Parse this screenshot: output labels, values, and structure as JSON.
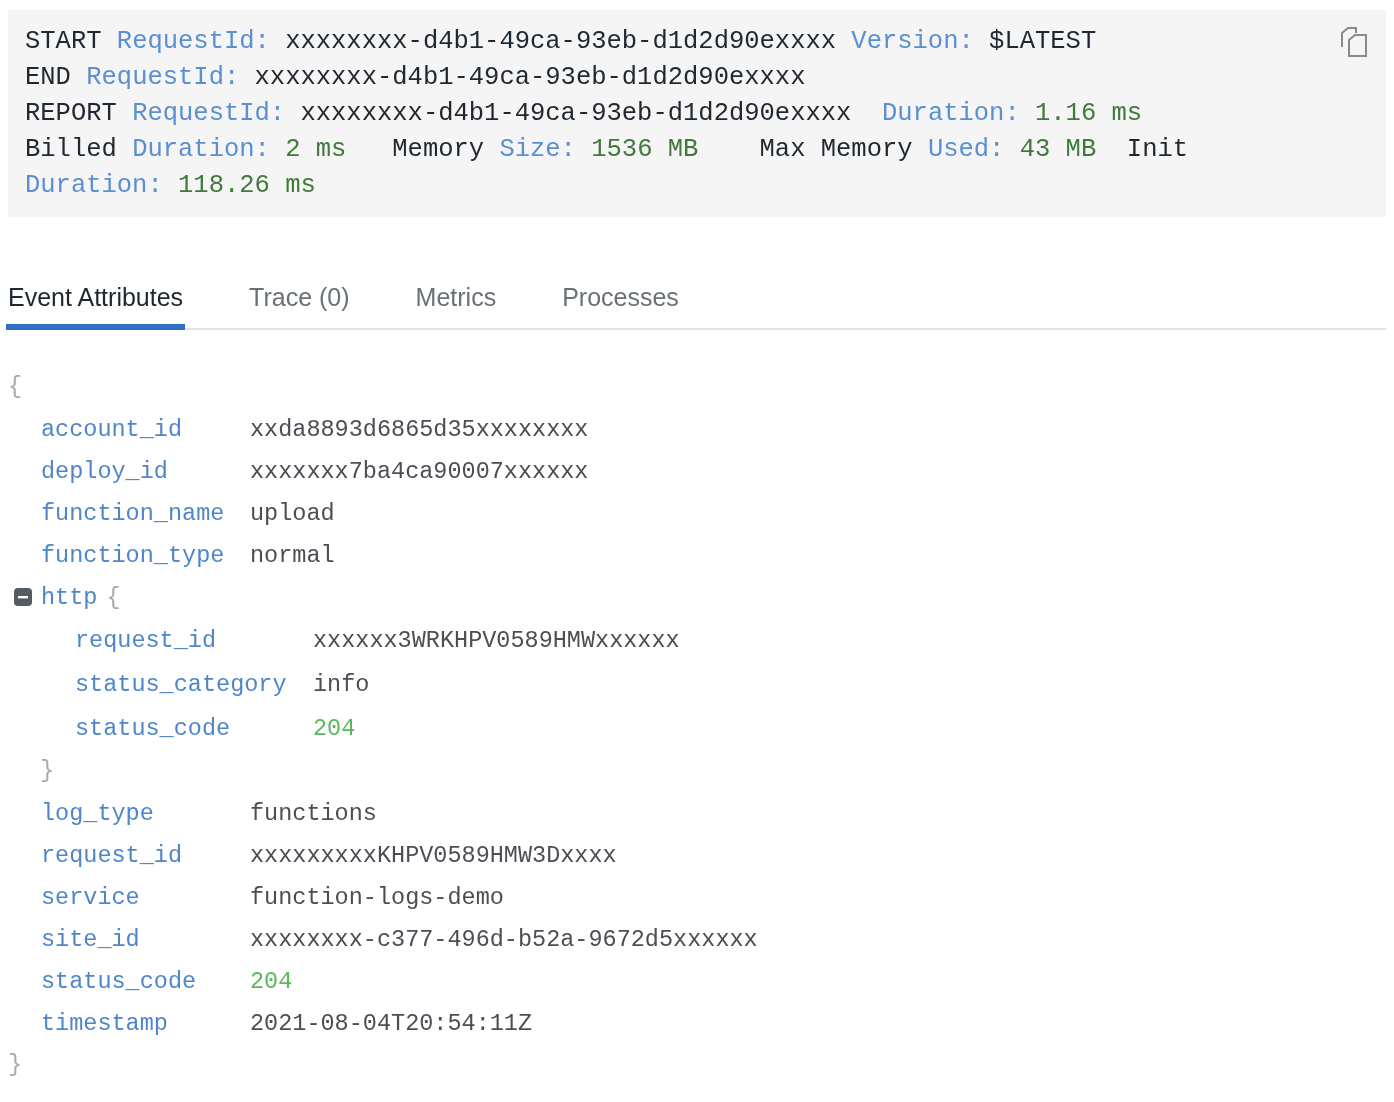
{
  "log": {
    "lines": [
      [
        {
          "kind": "plain",
          "text": "START "
        },
        {
          "kind": "key",
          "text": "RequestId:"
        },
        {
          "kind": "plain",
          "text": " xxxxxxxx-d4b1-49ca-93eb-d1d2d90exxxx "
        },
        {
          "kind": "key",
          "text": "Version:"
        },
        {
          "kind": "plain",
          "text": " $LATEST"
        }
      ],
      [
        {
          "kind": "plain",
          "text": "END "
        },
        {
          "kind": "key",
          "text": "RequestId:"
        },
        {
          "kind": "plain",
          "text": " xxxxxxxx-d4b1-49ca-93eb-d1d2d90exxxx"
        }
      ],
      [
        {
          "kind": "plain",
          "text": "REPORT "
        },
        {
          "kind": "key",
          "text": "RequestId:"
        },
        {
          "kind": "plain",
          "text": " xxxxxxxx-d4b1-49ca-93eb-d1d2d90exxxx  "
        },
        {
          "kind": "key",
          "text": "Duration:"
        },
        {
          "kind": "value",
          "text": " 1.16 ms"
        }
      ],
      [
        {
          "kind": "plain",
          "text": "Billed "
        },
        {
          "kind": "key",
          "text": "Duration:"
        },
        {
          "kind": "value",
          "text": " 2 ms"
        },
        {
          "kind": "plain",
          "text": "   Memory "
        },
        {
          "kind": "key",
          "text": "Size:"
        },
        {
          "kind": "value",
          "text": " 1536 MB"
        },
        {
          "kind": "plain",
          "text": "    Max Memory "
        },
        {
          "kind": "key",
          "text": "Used:"
        },
        {
          "kind": "value",
          "text": " 43 MB"
        },
        {
          "kind": "plain",
          "text": "  Init"
        }
      ],
      [
        {
          "kind": "key",
          "text": "Duration:"
        },
        {
          "kind": "value",
          "text": " 118.26 ms"
        }
      ]
    ]
  },
  "tabs": [
    {
      "label": "Event Attributes",
      "selected": true
    },
    {
      "label": "Trace (0)",
      "selected": false
    },
    {
      "label": "Metrics",
      "selected": false
    },
    {
      "label": "Processes",
      "selected": false
    }
  ],
  "attributes": {
    "open": "{",
    "close": "}",
    "items": [
      {
        "key": "account_id",
        "value": "xxda8893d6865d35xxxxxxxx",
        "kind": "string"
      },
      {
        "key": "deploy_id",
        "value": "xxxxxxx7ba4ca90007xxxxxx",
        "kind": "string"
      },
      {
        "key": "function_name",
        "value": "upload",
        "kind": "string"
      },
      {
        "key": "function_type",
        "value": "normal",
        "kind": "string"
      },
      {
        "key": "http",
        "kind": "object",
        "expanded": true,
        "open": "{",
        "close": "}",
        "children": [
          {
            "key": "request_id",
            "value": "xxxxxx3WRKHPV0589HMWxxxxxx",
            "kind": "string"
          },
          {
            "key": "status_category",
            "value": "info",
            "kind": "string"
          },
          {
            "key": "status_code",
            "value": "204",
            "kind": "number"
          }
        ]
      },
      {
        "key": "log_type",
        "value": "functions",
        "kind": "string"
      },
      {
        "key": "request_id",
        "value": "xxxxxxxxxKHPV0589HMW3Dxxxx",
        "kind": "string"
      },
      {
        "key": "service",
        "value": "function-logs-demo",
        "kind": "string"
      },
      {
        "key": "site_id",
        "value": "xxxxxxxx-c377-496d-b52a-9672d5xxxxxx",
        "kind": "string"
      },
      {
        "key": "status_code",
        "value": "204",
        "kind": "number"
      },
      {
        "key": "timestamp",
        "value": "2021-08-04T20:54:11Z",
        "kind": "string"
      }
    ]
  }
}
